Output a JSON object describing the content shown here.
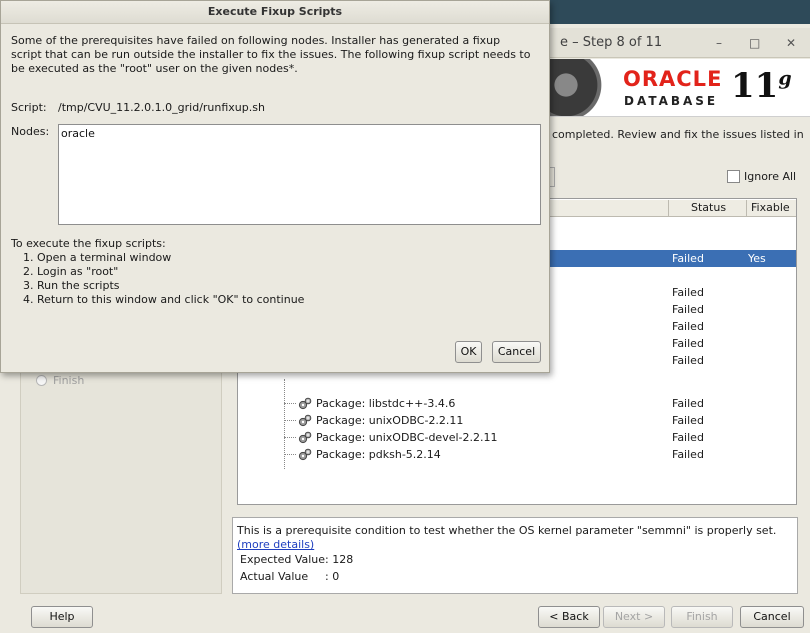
{
  "main_window": {
    "title": "e – Step 8 of 11",
    "controls": {
      "minimize": "–",
      "maximize": "□",
      "close": "✕"
    },
    "banner": {
      "logo": "ORACLE",
      "database": "DATABASE",
      "version": "11",
      "version_sup": "g"
    },
    "status_message": "completed. Review and fix the issues listed in",
    "ignore_all_label": "Ignore All",
    "nav": {
      "finish_label": "Finish"
    },
    "table": {
      "headers": {
        "status": "Status",
        "fixable": "Fixable"
      },
      "selected_row": {
        "status": "Failed",
        "fixable": "Yes"
      },
      "rows": [
        {
          "status": "Failed"
        },
        {
          "status": "Failed"
        },
        {
          "status": "Failed"
        },
        {
          "status": "Failed"
        },
        {
          "status": "Failed"
        },
        {
          "name": "Package: libstdc++-3.4.6",
          "status": "Failed"
        },
        {
          "name": "Package: unixODBC-2.2.11",
          "status": "Failed"
        },
        {
          "name": "Package: unixODBC-devel-2.2.11",
          "status": "Failed"
        },
        {
          "name": "Package: pdksh-5.2.14",
          "status": "Failed"
        }
      ]
    },
    "details": {
      "description": "This is a prerequisite condition to test whether the OS kernel parameter \"semmni\" is properly set.",
      "more_details_link": "(more details)",
      "expected_label": "Expected Value",
      "expected_value": ": 128",
      "actual_label": "Actual Value",
      "actual_value": ": 0"
    },
    "buttons": {
      "help": "Help",
      "back": "< Back",
      "next": "Next >",
      "finish": "Finish",
      "cancel": "Cancel"
    }
  },
  "fixup_dialog": {
    "title": "Execute Fixup Scripts",
    "message": "Some of the prerequisites have failed on following nodes. Installer has generated a fixup script that can be run outside the installer to fix the issues. The following fixup script needs to be executed as the \"root\" user on the given nodes*.",
    "script_label": "Script:",
    "script_value": "/tmp/CVU_11.2.0.1.0_grid/runfixup.sh",
    "nodes_label": "Nodes:",
    "nodes_value": "oracle",
    "instructions_heading": "To execute the fixup scripts:",
    "instructions": [
      "1. Open a terminal window",
      "2. Login as \"root\"",
      "3. Run the scripts",
      "4. Return to this window and click \"OK\" to continue"
    ],
    "ok_label": "OK",
    "cancel_label": "Cancel"
  }
}
